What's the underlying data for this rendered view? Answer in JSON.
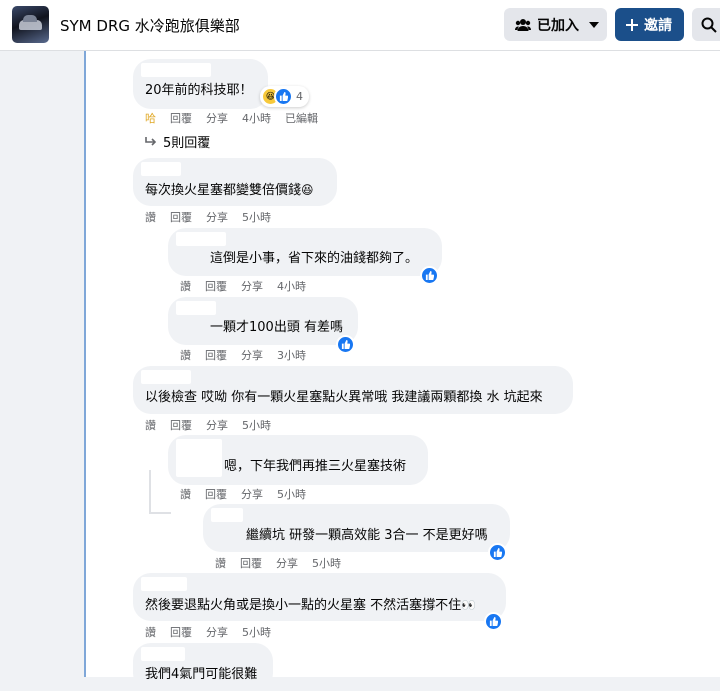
{
  "header": {
    "group_title": "SYM DRG 水冷跑旅俱樂部",
    "joined_label": "已加入",
    "invite_label": "邀請"
  },
  "comments": [
    {
      "text": "20年前的科技耶！",
      "reaction_label": "哈",
      "reply": "回覆",
      "share": "分享",
      "time": "4小時",
      "edited": "已編輯",
      "reaction_count": "4"
    },
    {
      "text": "每次換火星塞都變雙倍價錢",
      "like": "讚",
      "reply": "回覆",
      "share": "分享",
      "time": "5小時"
    },
    {
      "text": "這倒是小事，省下來的油錢都夠了。",
      "like": "讚",
      "reply": "回覆",
      "share": "分享",
      "time": "4小時"
    },
    {
      "text": "一顆才100出頭 有差嗎",
      "like": "讚",
      "reply": "回覆",
      "share": "分享",
      "time": "3小時"
    },
    {
      "text": "以後檢查 哎呦 你有一顆火星塞點火異常哦 我建議兩顆都換 水 坑起來",
      "like": "讚",
      "reply": "回覆",
      "share": "分享",
      "time": "5小時"
    },
    {
      "text": "嗯，下年我們再推三火星塞技術",
      "like": "讚",
      "reply": "回覆",
      "share": "分享",
      "time": "5小時"
    },
    {
      "text": "繼續坑 研發一顆高效能 3合一 不是更好嗎",
      "like": "讚",
      "reply": "回覆",
      "share": "分享",
      "time": "5小時"
    },
    {
      "text": "然後要退點火角或是換小一點的火星塞 不然活塞撐不住",
      "like": "讚",
      "reply": "回覆",
      "share": "分享",
      "time": "5小時"
    },
    {
      "text": "我們4氣門可能很難"
    }
  ],
  "more_replies": "5則回覆"
}
